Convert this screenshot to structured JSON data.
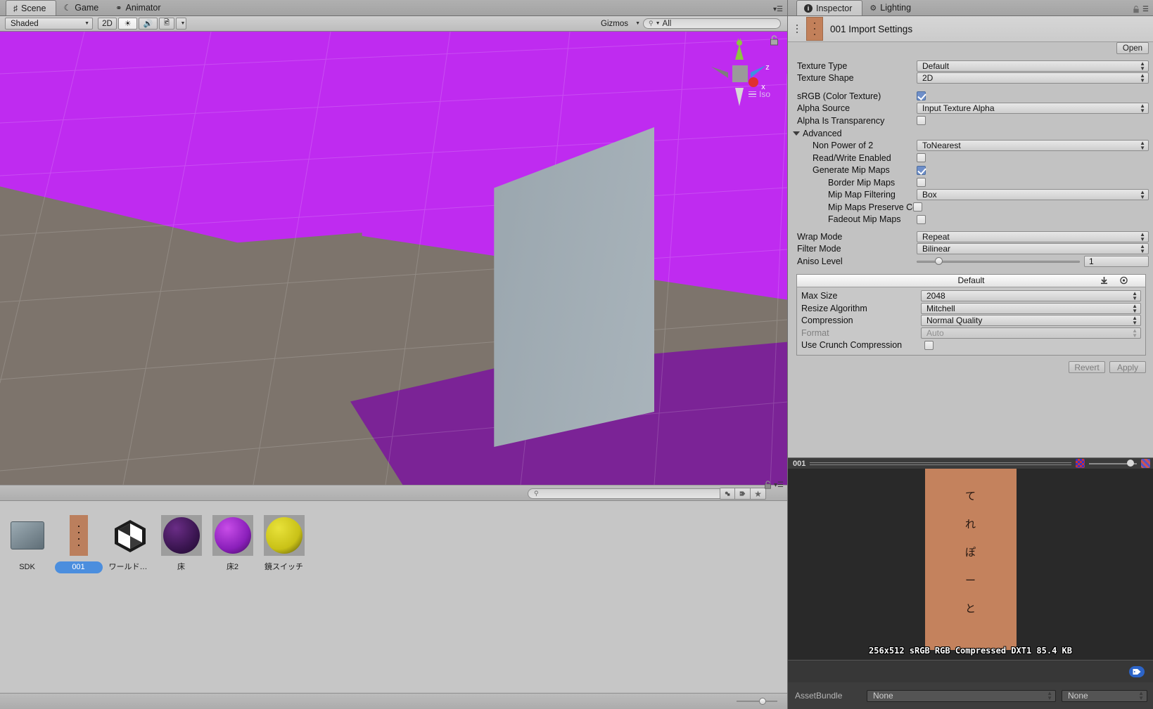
{
  "scene": {
    "tabs": [
      {
        "label": "Scene",
        "icon": "grid-icon",
        "active": true
      },
      {
        "label": "Game",
        "icon": "gamepad-icon",
        "active": false
      },
      {
        "label": "Animator",
        "icon": "animator-icon",
        "active": false
      }
    ],
    "toolbar": {
      "shading_mode": "Shaded",
      "mode_2d": "2D",
      "lighting_icon": "sun-icon",
      "audio_icon": "speaker-icon",
      "fx_icon": "image-icon",
      "gizmos_label": "Gizmos",
      "search_placeholder": "All",
      "search_value": "All",
      "search_icon": "search-icon"
    },
    "gizmo": {
      "axis_y": "y",
      "axis_z": "z",
      "axis_x": "x",
      "projection": "Iso"
    },
    "lock_icon": "lock-icon"
  },
  "project": {
    "search_value": "",
    "toolbar_icons": [
      "object-filter-icon",
      "label-filter-icon",
      "favorite-icon"
    ],
    "lock_icon": "lock-icon",
    "menu_icon": "hamburger-menu-icon",
    "assets": [
      {
        "label": "SDK",
        "type": "folder"
      },
      {
        "label": "001",
        "type": "texture",
        "selected": true
      },
      {
        "label": "ワールド作成...",
        "type": "prefab"
      },
      {
        "label": "床",
        "type": "material",
        "color": "#4a2060"
      },
      {
        "label": "床2",
        "type": "material",
        "color": "#9b27cd"
      },
      {
        "label": "鏡スイッチ",
        "type": "material",
        "color": "#ccc41e"
      }
    ],
    "zoom_value": "55"
  },
  "inspector": {
    "tabs": [
      {
        "label": "Inspector",
        "icon": "info-icon",
        "active": true
      },
      {
        "label": "Lighting",
        "icon": "lighting-icon",
        "active": false
      }
    ],
    "lock_icon": "lock-icon",
    "menu_icon": "hamburger-menu-icon",
    "title": "001 Import Settings",
    "open_button": "Open",
    "properties": [
      {
        "label": "Texture Type",
        "type": "dropdown",
        "value": "Default",
        "indent": 0
      },
      {
        "label": "Texture Shape",
        "type": "dropdown",
        "value": "2D",
        "indent": 0
      },
      {
        "label": "sRGB (Color Texture)",
        "type": "checkbox",
        "value": true,
        "indent": 0,
        "spacer_before": true
      },
      {
        "label": "Alpha Source",
        "type": "dropdown",
        "value": "Input Texture Alpha",
        "indent": 0
      },
      {
        "label": "Alpha Is Transparency",
        "type": "checkbox",
        "value": false,
        "indent": 0
      }
    ],
    "advanced": {
      "label": "Advanced",
      "expanded": true,
      "properties": [
        {
          "label": "Non Power of 2",
          "type": "dropdown",
          "value": "ToNearest",
          "indent": 1
        },
        {
          "label": "Read/Write Enabled",
          "type": "checkbox",
          "value": false,
          "indent": 1
        },
        {
          "label": "Generate Mip Maps",
          "type": "checkbox",
          "value": true,
          "indent": 1
        },
        {
          "label": "Border Mip Maps",
          "type": "checkbox",
          "value": false,
          "indent": 2
        },
        {
          "label": "Mip Map Filtering",
          "type": "dropdown",
          "value": "Box",
          "indent": 2
        },
        {
          "label": "Mip Maps Preserve Cove",
          "type": "checkbox",
          "value": false,
          "indent": 2
        },
        {
          "label": "Fadeout Mip Maps",
          "type": "checkbox",
          "value": false,
          "indent": 2
        }
      ]
    },
    "properties2": [
      {
        "label": "Wrap Mode",
        "type": "dropdown",
        "value": "Repeat",
        "indent": 0
      },
      {
        "label": "Filter Mode",
        "type": "dropdown",
        "value": "Bilinear",
        "indent": 0
      }
    ],
    "aniso": {
      "label": "Aniso Level",
      "value": "1"
    },
    "platform": {
      "tab_label": "Default",
      "download_icon": "download-icon",
      "target_icon": "platform-icon",
      "properties": [
        {
          "label": "Max Size",
          "type": "dropdown",
          "value": "2048",
          "disabled": false
        },
        {
          "label": "Resize Algorithm",
          "type": "dropdown",
          "value": "Mitchell",
          "disabled": false
        },
        {
          "label": "Compression",
          "type": "dropdown",
          "value": "Normal Quality",
          "disabled": false
        },
        {
          "label": "Format",
          "type": "dropdown",
          "value": "Auto",
          "disabled": true
        },
        {
          "label": "Use Crunch Compression",
          "type": "checkbox",
          "value": false,
          "disabled": false
        }
      ]
    },
    "revert_label": "Revert",
    "apply_label": "Apply"
  },
  "preview": {
    "name": "001",
    "rgb_icon": "rgb-channel-icon",
    "alpha_icon": "alpha-channel-icon",
    "mip_slider": "0",
    "texture_text": [
      "て",
      "れ",
      "ぽ",
      "ー",
      "と"
    ],
    "texture_color": "#c4825d",
    "info": "256x512 sRGB  RGB Compressed DXT1   85.4 KB",
    "tag_icon": "label-icon",
    "assetbundle_label": "AssetBundle",
    "assetbundle_name": "None",
    "assetbundle_variant": "None"
  }
}
